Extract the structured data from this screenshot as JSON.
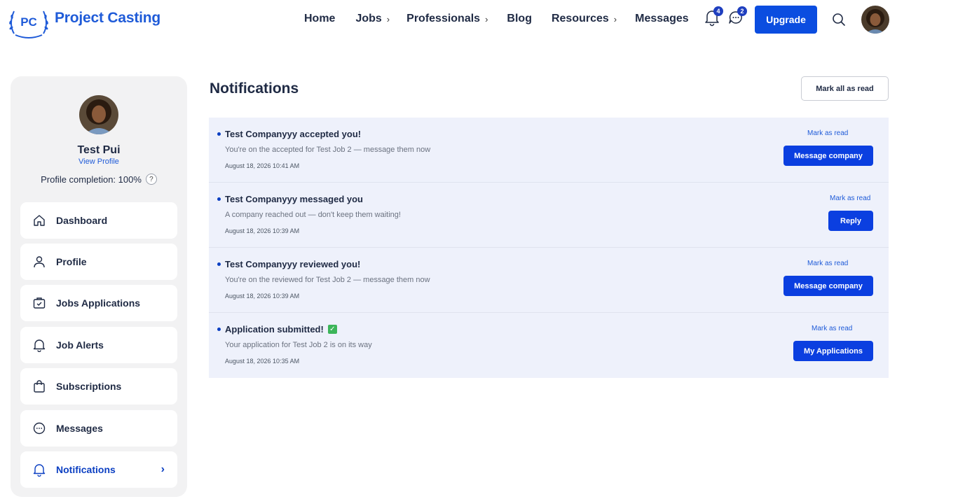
{
  "header": {
    "logo_mark": "PC",
    "logo_text": "Project Casting",
    "nav": [
      {
        "label": "Home",
        "chevron": false
      },
      {
        "label": "Jobs",
        "chevron": true
      },
      {
        "label": "Professionals",
        "chevron": true
      },
      {
        "label": "Blog",
        "chevron": false
      },
      {
        "label": "Resources",
        "chevron": true
      },
      {
        "label": "Messages",
        "chevron": false
      }
    ],
    "chevron_glyph": "›",
    "notification_count": "4",
    "message_count": "2",
    "upgrade_label": "Upgrade",
    "icons": [
      "bell-icon",
      "chat-icon",
      "search-icon",
      "avatar"
    ]
  },
  "sidebar": {
    "name": "Test Pui",
    "view_profile": "View Profile",
    "completion": "Profile completion: 100%",
    "help": "?",
    "items": [
      {
        "label": "Dashboard",
        "icon": "home-icon"
      },
      {
        "label": "Profile",
        "icon": "user-icon"
      },
      {
        "label": "Jobs Applications",
        "icon": "briefcase-check-icon"
      },
      {
        "label": "Job Alerts",
        "icon": "bell-icon"
      },
      {
        "label": "Subscriptions",
        "icon": "shopping-bag-icon"
      },
      {
        "label": "Messages",
        "icon": "chat-bubble-icon"
      },
      {
        "label": "Notifications",
        "icon": "bell-icon",
        "active": true
      }
    ],
    "active_arrow": "›"
  },
  "main": {
    "title": "Notifications",
    "mark_all": "Mark all as read",
    "notifications": [
      {
        "title": "Test Companyyy accepted you!",
        "message": "You're on the accepted for Test Job 2 — message them now",
        "date": "August 18, 2026 10:41 AM",
        "mark_read": "Mark as read",
        "action": "Message company"
      },
      {
        "title": "Test Companyyy messaged you",
        "message": "A company reached out — don't keep them waiting!",
        "date": "August 18, 2026 10:39 AM",
        "mark_read": "Mark as read",
        "action": "Reply"
      },
      {
        "title": "Test Companyyy reviewed you!",
        "message": "You're on the reviewed for Test Job 2 — message them now",
        "date": "August 18, 2026 10:39 AM",
        "mark_read": "Mark as read",
        "action": "Message company"
      },
      {
        "title": "Application submitted!",
        "message": "Your application for Test Job 2 is on its way",
        "date": "August 18, 2026 10:35 AM",
        "mark_read": "Mark as read",
        "action": "My Applications",
        "emoji": "✓"
      }
    ]
  },
  "colors": {
    "brand_blue": "#0b4de0",
    "link_blue": "#1f5bd8",
    "notif_bg": "#eef1fb",
    "sidebar_bg": "#f2f2f3"
  }
}
